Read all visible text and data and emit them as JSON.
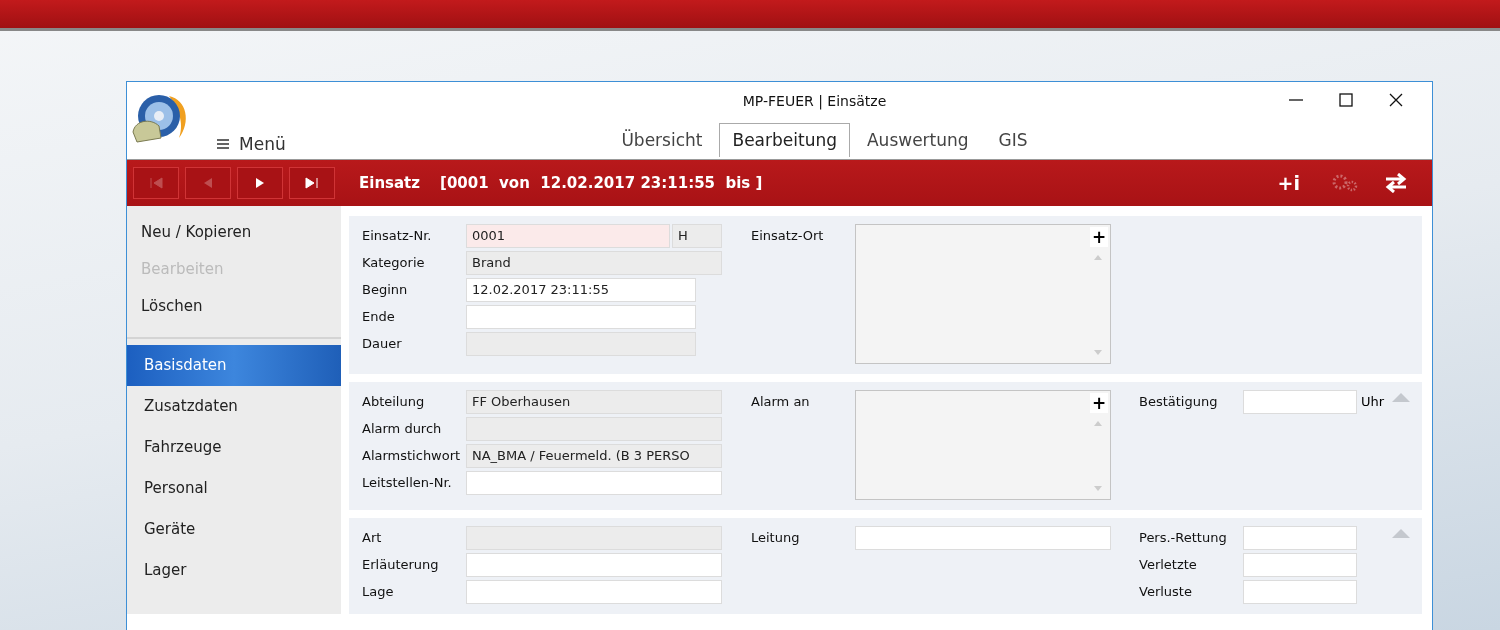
{
  "window": {
    "title": "MP-FEUER | Einsätze",
    "menu_label": "Menü"
  },
  "tabs": [
    {
      "label": "Übersicht",
      "selected": false
    },
    {
      "label": "Bearbeitung",
      "selected": true
    },
    {
      "label": "Auswertung",
      "selected": false
    },
    {
      "label": "GIS",
      "selected": false
    }
  ],
  "toolbar": {
    "nav_buttons": [
      {
        "kind": "first",
        "disabled": true
      },
      {
        "kind": "prev",
        "disabled": true
      },
      {
        "kind": "next",
        "disabled": false
      },
      {
        "kind": "last",
        "disabled": false
      }
    ],
    "title": "Einsatz",
    "record": "[0001  von  12.02.2017 23:11:55  bis ]",
    "actions": [
      {
        "kind": "add-info",
        "label": "+i",
        "disabled": false
      },
      {
        "kind": "gears",
        "disabled": true
      },
      {
        "kind": "swap",
        "disabled": false
      }
    ]
  },
  "sidebar": {
    "actions": [
      {
        "label": "Neu / Kopieren",
        "disabled": false
      },
      {
        "label": "Bearbeiten",
        "disabled": true
      },
      {
        "label": "Löschen",
        "disabled": false
      }
    ],
    "items": [
      {
        "label": "Basisdaten",
        "selected": true
      },
      {
        "label": "Zusatzdaten",
        "selected": false
      },
      {
        "label": "Fahrzeuge",
        "selected": false
      },
      {
        "label": "Personal",
        "selected": false
      },
      {
        "label": "Geräte",
        "selected": false
      },
      {
        "label": "Lager",
        "selected": false
      }
    ]
  },
  "sections": [
    {
      "collapsible": false,
      "columns": [
        [
          {
            "label": "Einsatz-Nr.",
            "kind": "key",
            "value": "0001",
            "suffix": "H"
          },
          {
            "label": "Kategorie",
            "kind": "readonly",
            "value": "Brand"
          },
          {
            "label": "Beginn",
            "kind": "input",
            "value": "12.02.2017 23:11:55",
            "short": true
          },
          {
            "label": "Ende",
            "kind": "input",
            "short": true
          },
          {
            "label": "Dauer",
            "kind": "readonly",
            "short": true
          }
        ],
        [
          {
            "label": "Einsatz-Ort",
            "kind": "list",
            "add": "+"
          }
        ],
        []
      ]
    },
    {
      "collapsible": true,
      "columns": [
        [
          {
            "label": "Abteilung",
            "kind": "readonly",
            "value": "FF Oberhausen"
          },
          {
            "label": "Alarm durch",
            "kind": "readonly"
          },
          {
            "label": "Alarmstichwort",
            "kind": "readonly",
            "value": "NA_BMA / Feuermeld. (B 3 PERSO"
          },
          {
            "label": "Leitstellen-Nr.",
            "kind": "input"
          }
        ],
        [
          {
            "label": "Alarm an",
            "kind": "list",
            "add": "+"
          }
        ],
        [
          {
            "label": "Bestätigung",
            "kind": "input",
            "unit": "Uhr"
          }
        ]
      ]
    },
    {
      "collapsible": true,
      "columns": [
        [
          {
            "label": "Art",
            "kind": "readonly"
          },
          {
            "label": "Erläuterung",
            "kind": "input"
          },
          {
            "label": "Lage",
            "kind": "input"
          }
        ],
        [
          {
            "label": "Leitung",
            "kind": "input"
          }
        ],
        [
          {
            "label": "Pers.-Rettung",
            "kind": "input"
          },
          {
            "label": "Verletzte",
            "kind": "input"
          },
          {
            "label": "Verluste",
            "kind": "input"
          }
        ]
      ]
    }
  ]
}
